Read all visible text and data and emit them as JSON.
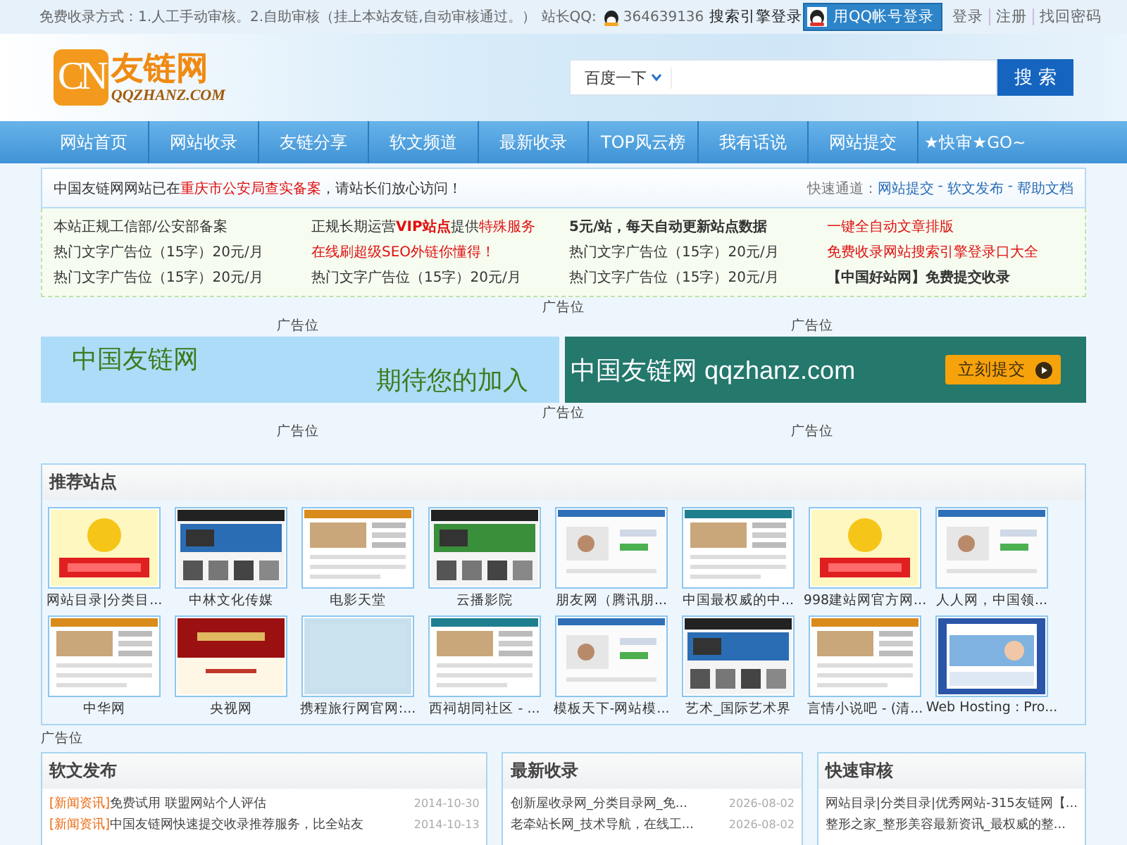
{
  "top_bar": {
    "notice": "免费收录方式：1.人工手动审核。2.自助审核（挂上本站友链,自动审核通过。）",
    "qq_label": "站长QQ:",
    "qq_number": "364639136",
    "search_login": "搜索引擎登录",
    "qq_login_button": "用QQ帐号登录",
    "links": [
      "登录",
      "注册",
      "找回密码"
    ]
  },
  "header": {
    "logo_badge": "CN",
    "logo_title": "友链网",
    "logo_domain": "QQZHANZ.COM",
    "search_engine": "百度一下",
    "search_button": "搜 索"
  },
  "nav": [
    "网站首页",
    "网站收录",
    "友链分享",
    "软文频道",
    "最新收录",
    "TOP风云榜",
    "我有话说",
    "网站提交",
    "★快审★GO~"
  ],
  "notice": {
    "before": "中国友链网网站已在",
    "highlight": "重庆市公安局查实备案",
    "after": "，请站长们放心访问！",
    "quick_label": "快速通道：",
    "quick_links": [
      "网站提交",
      "软文发布",
      "帮助文档"
    ],
    "quick_separator": "-"
  },
  "text_ads": [
    {
      "parts": [
        {
          "text": "本站正规工信部/公安部备案",
          "red": false,
          "bold": false
        }
      ]
    },
    {
      "parts": [
        {
          "text": "正规长期运营",
          "red": false,
          "bold": false
        },
        {
          "text": "VIP站点",
          "red": true,
          "bold": true
        },
        {
          "text": "提供",
          "red": false,
          "bold": false
        },
        {
          "text": "特殊服务",
          "red": true,
          "bold": false
        }
      ]
    },
    {
      "parts": [
        {
          "text": "5元/站，每天自动更新站点数据",
          "red": false,
          "bold": true
        }
      ]
    },
    {
      "parts": [
        {
          "text": "一键全自动文章排版",
          "red": true,
          "bold": false
        }
      ]
    },
    {
      "parts": [
        {
          "text": "热门文字广告位（15字）20元/月",
          "red": false,
          "bold": false
        }
      ]
    },
    {
      "parts": [
        {
          "text": "在线刷超级SEO外链你懂得！",
          "red": true,
          "bold": false
        }
      ]
    },
    {
      "parts": [
        {
          "text": "热门文字广告位（15字）20元/月",
          "red": false,
          "bold": false
        }
      ]
    },
    {
      "parts": [
        {
          "text": "免费收录网站搜索引擎登录口大全",
          "red": true,
          "bold": false
        }
      ]
    },
    {
      "parts": [
        {
          "text": "热门文字广告位（15字）20元/月",
          "red": false,
          "bold": false
        }
      ]
    },
    {
      "parts": [
        {
          "text": "热门文字广告位（15字）20元/月",
          "red": false,
          "bold": false
        }
      ]
    },
    {
      "parts": [
        {
          "text": "热门文字广告位（15字）20元/月",
          "red": false,
          "bold": false
        }
      ]
    },
    {
      "parts": [
        {
          "text": "【中国好站网】免费提交收录",
          "red": false,
          "bold": true
        }
      ]
    }
  ],
  "ad_slots": {
    "top_center": "广告位",
    "top_pair": [
      "广告位",
      "广告位"
    ],
    "mid_center": "广告位",
    "bottom_pair": [
      "广告位",
      "广告位"
    ],
    "after_recommend": "广告位"
  },
  "banners": {
    "left_title": "中国友链网",
    "left_slogan": "期待您的加入",
    "right_title": "中国友链网 qqzhanz.com",
    "right_button": "立刻提交"
  },
  "recommend": {
    "title": "推荐站点",
    "sites": [
      {
        "name": "网站目录|分类目...",
        "kind": "lost"
      },
      {
        "name": "中林文化传媒",
        "kind": "dark"
      },
      {
        "name": "电影天堂",
        "kind": "page"
      },
      {
        "name": "云播影院",
        "kind": "dark"
      },
      {
        "name": "朋友网（腾讯朋...",
        "kind": "light"
      },
      {
        "name": "中国最权威的中...",
        "kind": "page"
      },
      {
        "name": "998建站网官方网...",
        "kind": "lost"
      },
      {
        "name": "人人网，中国领...",
        "kind": "light"
      },
      {
        "name": "中华网",
        "kind": "page"
      },
      {
        "name": "央视网",
        "kind": "red"
      },
      {
        "name": "携程旅行网官网:...",
        "kind": "blank"
      },
      {
        "name": "西祠胡同社区 - ...",
        "kind": "page"
      },
      {
        "name": "模板天下-网站模...",
        "kind": "light"
      },
      {
        "name": "艺术_国际艺术界",
        "kind": "dark"
      },
      {
        "name": "言情小说吧 - (清...",
        "kind": "page"
      },
      {
        "name": "Web Hosting : Pro...",
        "kind": "blue"
      }
    ]
  },
  "panels": [
    {
      "title": "软文发布",
      "items": [
        {
          "tag": "[新闻资讯]",
          "text": "免费试用 联盟网站个人评估",
          "date": "2014-10-30"
        },
        {
          "tag": "[新闻资讯]",
          "text": "中国友链网快速提交收录推荐服务，比全站友",
          "date": "2014-10-13"
        }
      ]
    },
    {
      "title": "最新收录",
      "items": [
        {
          "text": "创新屋收录网_分类目录网_免...",
          "date": "2026-08-02"
        },
        {
          "text": "老牵站长网_技术导航，在线工...",
          "date": "2026-08-02"
        }
      ]
    },
    {
      "title": "快速审核",
      "items": [
        {
          "text": "网站目录|分类目录|优秀网站-315友链网【..."
        },
        {
          "text": "整形之家_整形美容最新资讯_最权威的整..."
        }
      ]
    }
  ]
}
